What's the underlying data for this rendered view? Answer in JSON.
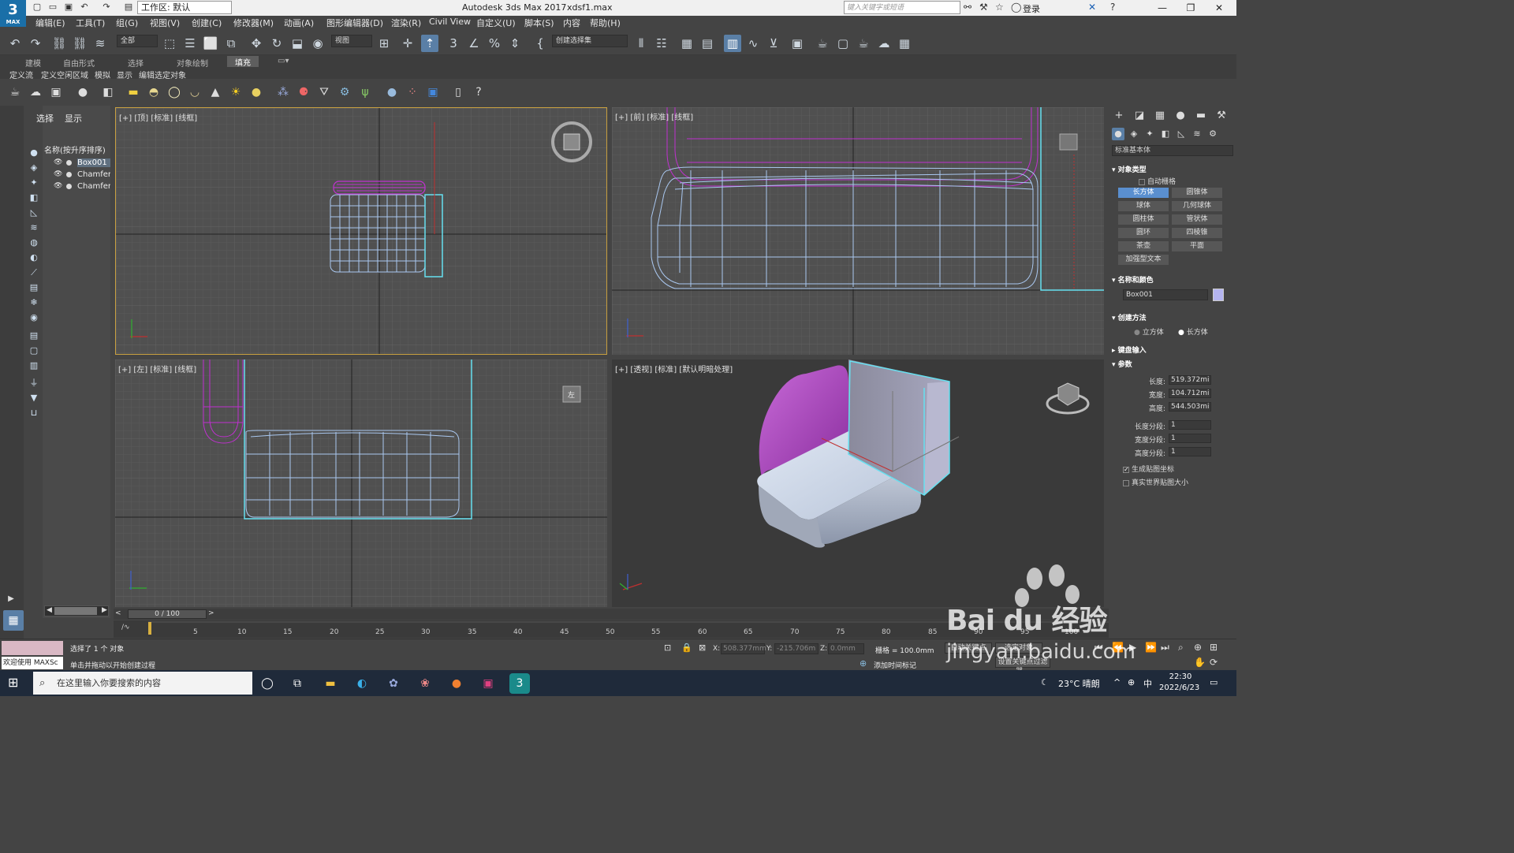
{
  "titlebar": {
    "logo": "3",
    "logo_sub": "MAX",
    "workspace": "工作区: 默认",
    "app_title": "Autodesk 3ds Max 2017",
    "file_title": "xdsf1.max",
    "search_placeholder": "键入关键字或短语",
    "login": "登录"
  },
  "menu": [
    "编辑(E)",
    "工具(T)",
    "组(G)",
    "视图(V)",
    "创建(C)",
    "修改器(M)",
    "动画(A)",
    "图形编辑器(D)",
    "渲染(R)",
    "Civil View",
    "自定义(U)",
    "脚本(S)",
    "内容",
    "帮助(H)"
  ],
  "toolbar": {
    "filter_select": "全部",
    "ref_coord": "视图",
    "named_selection": "创建选择集"
  },
  "ribbon": {
    "tabs": [
      "建模",
      "自由形式",
      "选择",
      "对象绘制",
      "填充"
    ],
    "active_tab": "填充",
    "sub_tabs": [
      "定义流",
      "定义空闲区域",
      "模拟",
      "显示",
      "编辑选定对象"
    ]
  },
  "explorer": {
    "tabs": [
      "选择",
      "显示"
    ],
    "header": "名称(按升序排序)",
    "items": [
      "Box001",
      "Chamfer",
      "Chamfer"
    ],
    "selected": "Box001"
  },
  "viewports": {
    "top": "[+] [顶] [标准] [线框]",
    "front": "[+] [前] [标准] [线框]",
    "left": "[+] [左] [标准] [线框]",
    "persp": "[+] [透视] [标准] [默认明暗处理]",
    "viewcube_left": "左"
  },
  "command_panel": {
    "category": "标准基本体",
    "rollouts": {
      "object_type": "对象类型",
      "name_color": "名称和颜色",
      "creation_method": "创建方法",
      "keyboard_entry": "键盘输入",
      "parameters": "参数"
    },
    "autogrid": "自动栅格",
    "object_buttons": [
      "长方体",
      "圆锥体",
      "球体",
      "几何球体",
      "圆柱体",
      "管状体",
      "圆环",
      "四棱锥",
      "茶壶",
      "平面",
      "加强型文本"
    ],
    "active_button": "长方体",
    "object_name": "Box001",
    "swatch_color": "#b4b4f0",
    "creation_options": [
      "立方体",
      "长方体"
    ],
    "creation_selected": "长方体",
    "params": [
      {
        "label": "长度:",
        "value": "519.372mi"
      },
      {
        "label": "宽度:",
        "value": "104.712mi"
      },
      {
        "label": "高度:",
        "value": "544.503mi"
      },
      {
        "label": "长度分段:",
        "value": "1"
      },
      {
        "label": "宽度分段:",
        "value": "1"
      },
      {
        "label": "高度分段:",
        "value": "1"
      }
    ],
    "gen_mapping": "生成贴图坐标",
    "real_world": "真实世界贴图大小"
  },
  "timeline": {
    "frame": "0 / 100",
    "ticks": [
      "5",
      "10",
      "15",
      "20",
      "25",
      "30",
      "35",
      "40",
      "45",
      "50",
      "55",
      "60",
      "65",
      "70",
      "75",
      "80",
      "85",
      "90",
      "95",
      "100"
    ]
  },
  "status": {
    "welcome": "欢迎使用 MAXSc",
    "selected": "选择了 1 个 对象",
    "prompt": "单击并拖动以开始创建过程",
    "x_label": "X:",
    "x_val": "508.377mm",
    "y_label": "Y:",
    "y_val": "-215.706m",
    "z_label": "Z:",
    "z_val": "0.0mm",
    "grid": "栅格 = 100.0mm",
    "auto_key": "自动关键点",
    "selected_obj": "选定对象",
    "add_time_tag": "添加时间标记",
    "set_key": "设置关键点过滤器..."
  },
  "taskbar": {
    "search": "在这里输入你要搜索的内容",
    "weather": "23°C 晴朗",
    "ime": "中",
    "time": "22:30",
    "date": "2022/6/23"
  },
  "watermark": {
    "brand": "Bai du 经验",
    "url": "jingyan.baidu.com"
  },
  "colors": {
    "accent": "#5a7fa6",
    "selected_wire": "#66d9e8",
    "purple_wire": "#b030c0",
    "cushion": "#b24ec6"
  }
}
